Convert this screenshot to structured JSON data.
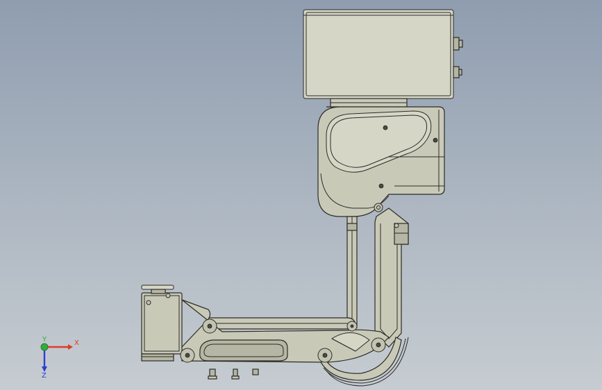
{
  "triad": {
    "x_label": "X",
    "y_label": "Y",
    "z_label": "Z",
    "colors": {
      "x": "#e03a2a",
      "y": "#2fae3a",
      "z": "#2b3fd0"
    }
  },
  "colors": {
    "background_top": "#8f9db0",
    "background_bottom": "#c6ccd1",
    "part_fill": "#c9c9b8",
    "edge": "#2b2b27"
  }
}
